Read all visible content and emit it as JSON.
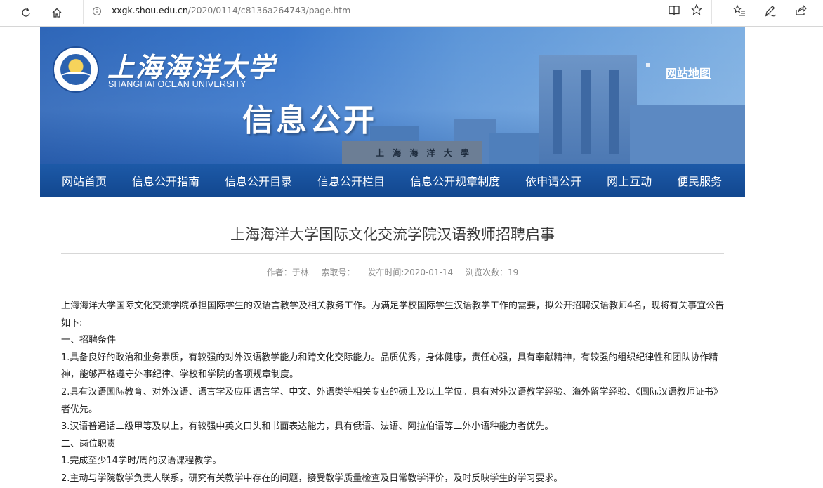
{
  "browser": {
    "url_host": "xxgk.shou.edu.cn",
    "url_path": "/2020/0114/c8136a264743/page.htm"
  },
  "banner": {
    "cn_name": "上海海洋大学",
    "en_name": "SHANGHAI OCEAN UNIVERSITY",
    "section_title": "信息公开",
    "sitemap_link": "网站地图",
    "gate_text": "上 海 海 洋 大 學"
  },
  "nav": {
    "items": [
      "网站首页",
      "信息公开指南",
      "信息公开目录",
      "信息公开栏目",
      "信息公开规章制度",
      "依申请公开",
      "网上互动",
      "便民服务"
    ]
  },
  "article": {
    "title": "上海海洋大学国际文化交流学院汉语教师招聘启事",
    "author": "作者：于林",
    "source": "索取号：",
    "date": "发布时间:2020-01-14",
    "views": "浏览次数：19",
    "paragraphs": [
      "上海海洋大学国际文化交流学院承担国际学生的汉语言教学及相关教务工作。为满足学校国际学生汉语教学工作的需要，拟公开招聘汉语教师4名，现将有关事宜公告如下:",
      "一、招聘条件",
      "1.具备良好的政治和业务素质，有较强的对外汉语教学能力和跨文化交际能力。品质优秀，身体健康，责任心强，具有奉献精神，有较强的组织纪律性和团队协作精神，能够严格遵守外事纪律、学校和学院的各项规章制度。",
      "2.具有汉语国际教育、对外汉语、语言学及应用语言学、中文、外语类等相关专业的硕士及以上学位。具有对外汉语教学经验、海外留学经验、《国际汉语教师证书》者优先。",
      "3.汉语普通话二级甲等及以上，有较强中英文口头和书面表达能力，具有俄语、法语、阿拉伯语等二外小语种能力者优先。",
      "二、岗位职责",
      "1.完成至少14学时/周的汉语课程教学。",
      "2.主动与学院教学负责人联系，研究有关教学中存在的问题，接受教学质量检查及日常教学评价，及时反映学生的学习要求。"
    ]
  }
}
